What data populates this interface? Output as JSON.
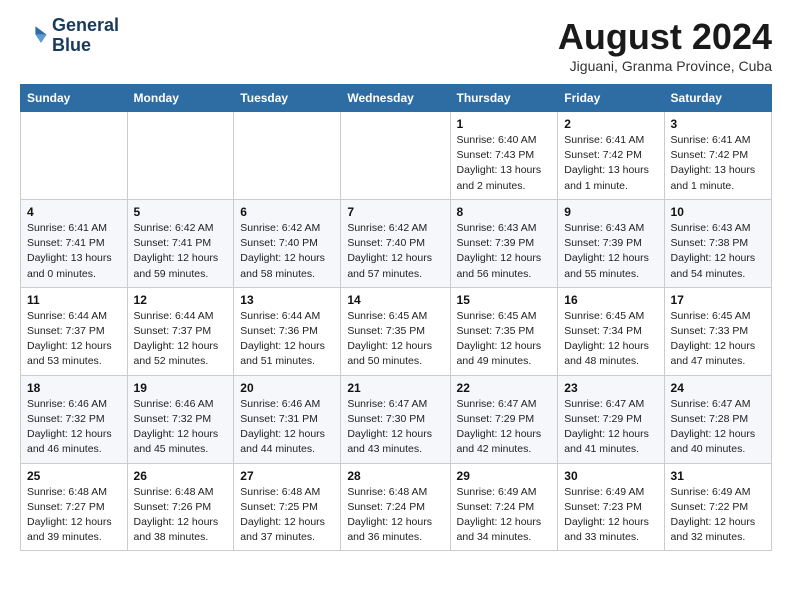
{
  "logo": {
    "line1": "General",
    "line2": "Blue"
  },
  "title": "August 2024",
  "subtitle": "Jiguani, Granma Province, Cuba",
  "weekdays": [
    "Sunday",
    "Monday",
    "Tuesday",
    "Wednesday",
    "Thursday",
    "Friday",
    "Saturday"
  ],
  "weeks": [
    [
      {
        "day": "",
        "info": ""
      },
      {
        "day": "",
        "info": ""
      },
      {
        "day": "",
        "info": ""
      },
      {
        "day": "",
        "info": ""
      },
      {
        "day": "1",
        "info": "Sunrise: 6:40 AM\nSunset: 7:43 PM\nDaylight: 13 hours\nand 2 minutes."
      },
      {
        "day": "2",
        "info": "Sunrise: 6:41 AM\nSunset: 7:42 PM\nDaylight: 13 hours\nand 1 minute."
      },
      {
        "day": "3",
        "info": "Sunrise: 6:41 AM\nSunset: 7:42 PM\nDaylight: 13 hours\nand 1 minute."
      }
    ],
    [
      {
        "day": "4",
        "info": "Sunrise: 6:41 AM\nSunset: 7:41 PM\nDaylight: 13 hours\nand 0 minutes."
      },
      {
        "day": "5",
        "info": "Sunrise: 6:42 AM\nSunset: 7:41 PM\nDaylight: 12 hours\nand 59 minutes."
      },
      {
        "day": "6",
        "info": "Sunrise: 6:42 AM\nSunset: 7:40 PM\nDaylight: 12 hours\nand 58 minutes."
      },
      {
        "day": "7",
        "info": "Sunrise: 6:42 AM\nSunset: 7:40 PM\nDaylight: 12 hours\nand 57 minutes."
      },
      {
        "day": "8",
        "info": "Sunrise: 6:43 AM\nSunset: 7:39 PM\nDaylight: 12 hours\nand 56 minutes."
      },
      {
        "day": "9",
        "info": "Sunrise: 6:43 AM\nSunset: 7:39 PM\nDaylight: 12 hours\nand 55 minutes."
      },
      {
        "day": "10",
        "info": "Sunrise: 6:43 AM\nSunset: 7:38 PM\nDaylight: 12 hours\nand 54 minutes."
      }
    ],
    [
      {
        "day": "11",
        "info": "Sunrise: 6:44 AM\nSunset: 7:37 PM\nDaylight: 12 hours\nand 53 minutes."
      },
      {
        "day": "12",
        "info": "Sunrise: 6:44 AM\nSunset: 7:37 PM\nDaylight: 12 hours\nand 52 minutes."
      },
      {
        "day": "13",
        "info": "Sunrise: 6:44 AM\nSunset: 7:36 PM\nDaylight: 12 hours\nand 51 minutes."
      },
      {
        "day": "14",
        "info": "Sunrise: 6:45 AM\nSunset: 7:35 PM\nDaylight: 12 hours\nand 50 minutes."
      },
      {
        "day": "15",
        "info": "Sunrise: 6:45 AM\nSunset: 7:35 PM\nDaylight: 12 hours\nand 49 minutes."
      },
      {
        "day": "16",
        "info": "Sunrise: 6:45 AM\nSunset: 7:34 PM\nDaylight: 12 hours\nand 48 minutes."
      },
      {
        "day": "17",
        "info": "Sunrise: 6:45 AM\nSunset: 7:33 PM\nDaylight: 12 hours\nand 47 minutes."
      }
    ],
    [
      {
        "day": "18",
        "info": "Sunrise: 6:46 AM\nSunset: 7:32 PM\nDaylight: 12 hours\nand 46 minutes."
      },
      {
        "day": "19",
        "info": "Sunrise: 6:46 AM\nSunset: 7:32 PM\nDaylight: 12 hours\nand 45 minutes."
      },
      {
        "day": "20",
        "info": "Sunrise: 6:46 AM\nSunset: 7:31 PM\nDaylight: 12 hours\nand 44 minutes."
      },
      {
        "day": "21",
        "info": "Sunrise: 6:47 AM\nSunset: 7:30 PM\nDaylight: 12 hours\nand 43 minutes."
      },
      {
        "day": "22",
        "info": "Sunrise: 6:47 AM\nSunset: 7:29 PM\nDaylight: 12 hours\nand 42 minutes."
      },
      {
        "day": "23",
        "info": "Sunrise: 6:47 AM\nSunset: 7:29 PM\nDaylight: 12 hours\nand 41 minutes."
      },
      {
        "day": "24",
        "info": "Sunrise: 6:47 AM\nSunset: 7:28 PM\nDaylight: 12 hours\nand 40 minutes."
      }
    ],
    [
      {
        "day": "25",
        "info": "Sunrise: 6:48 AM\nSunset: 7:27 PM\nDaylight: 12 hours\nand 39 minutes."
      },
      {
        "day": "26",
        "info": "Sunrise: 6:48 AM\nSunset: 7:26 PM\nDaylight: 12 hours\nand 38 minutes."
      },
      {
        "day": "27",
        "info": "Sunrise: 6:48 AM\nSunset: 7:25 PM\nDaylight: 12 hours\nand 37 minutes."
      },
      {
        "day": "28",
        "info": "Sunrise: 6:48 AM\nSunset: 7:24 PM\nDaylight: 12 hours\nand 36 minutes."
      },
      {
        "day": "29",
        "info": "Sunrise: 6:49 AM\nSunset: 7:24 PM\nDaylight: 12 hours\nand 34 minutes."
      },
      {
        "day": "30",
        "info": "Sunrise: 6:49 AM\nSunset: 7:23 PM\nDaylight: 12 hours\nand 33 minutes."
      },
      {
        "day": "31",
        "info": "Sunrise: 6:49 AM\nSunset: 7:22 PM\nDaylight: 12 hours\nand 32 minutes."
      }
    ]
  ]
}
